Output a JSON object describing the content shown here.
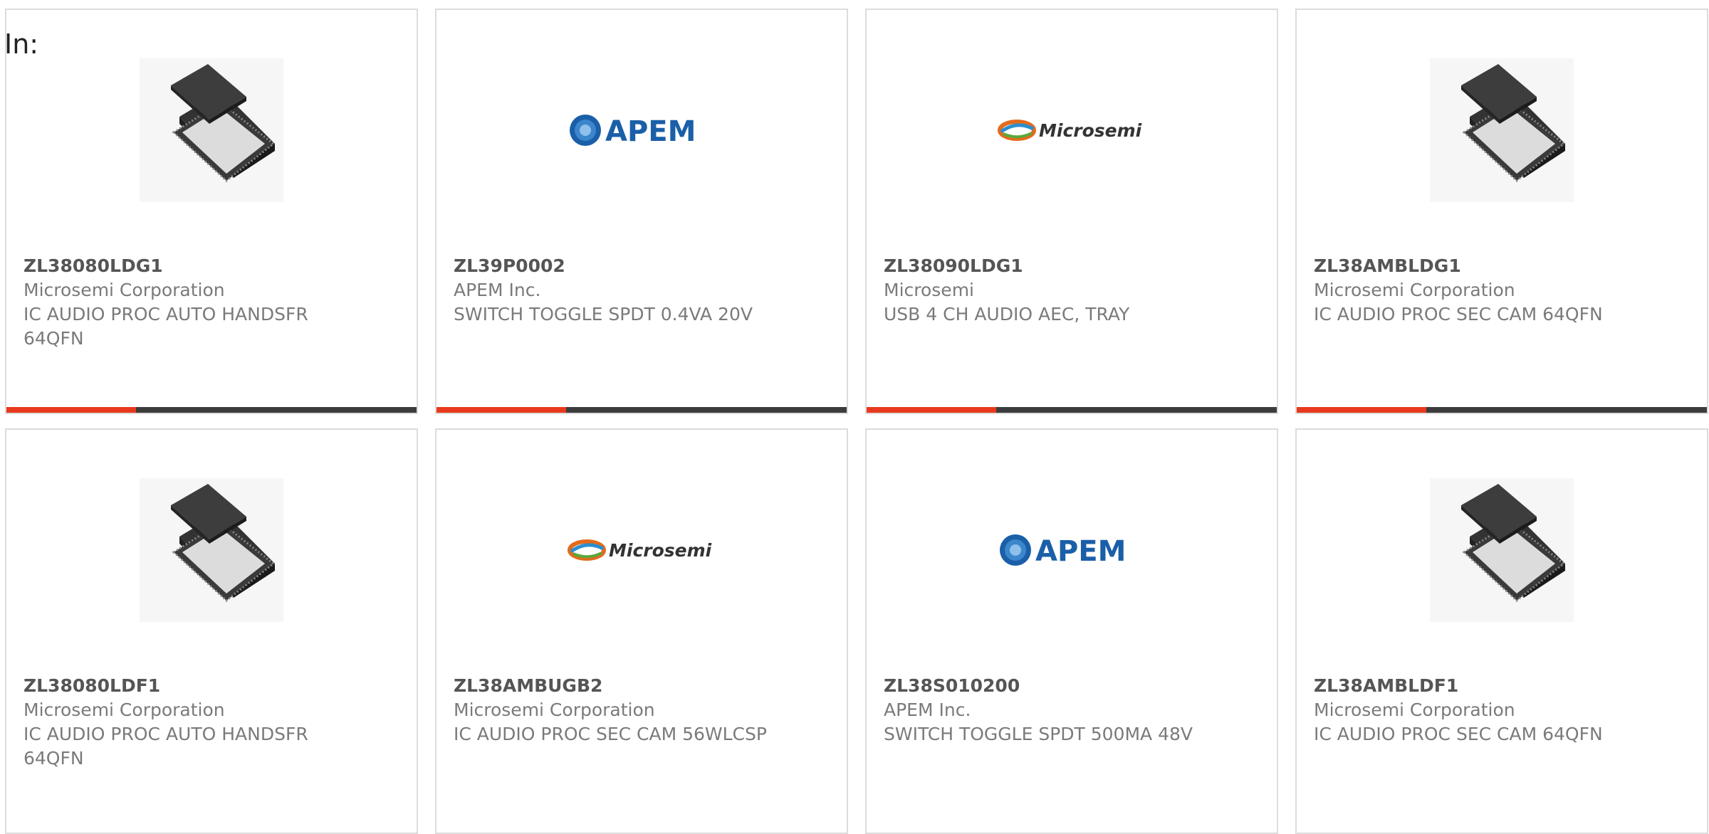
{
  "filter": {
    "prefix_label": "In:"
  },
  "colors": {
    "card_border": "#dcdcdc",
    "text_primary": "#555555",
    "text_secondary": "#7a7a7a",
    "accent_orange": "#e8391d",
    "bar_dark": "#3c3c3c",
    "apem_blue": "#1a5fa8"
  },
  "products": [
    {
      "part_number": "ZL38080LDG1",
      "manufacturer": "Microsemi Corporation",
      "description": "IC AUDIO PROC AUTO HANDSFR 64QFN",
      "image": "qfn-chip-icon"
    },
    {
      "part_number": "ZL39P0002",
      "manufacturer": "APEM Inc.",
      "description": "SWITCH TOGGLE SPDT 0.4VA 20V",
      "image": "apem-logo",
      "logo_text": "APEM"
    },
    {
      "part_number": "ZL38090LDG1",
      "manufacturer": "Microsemi",
      "description": "USB 4 CH AUDIO AEC, TRAY",
      "image": "microsemi-logo",
      "logo_text": "Microsemi"
    },
    {
      "part_number": "ZL38AMBLDG1",
      "manufacturer": "Microsemi Corporation",
      "description": "IC AUDIO PROC SEC CAM 64QFN",
      "image": "qfn-chip-icon"
    },
    {
      "part_number": "ZL38080LDF1",
      "manufacturer": "Microsemi Corporation",
      "description": "IC AUDIO PROC AUTO HANDSFR 64QFN",
      "image": "qfn-chip-icon"
    },
    {
      "part_number": "ZL38AMBUGB2",
      "manufacturer": "Microsemi Corporation",
      "description": "IC AUDIO PROC SEC CAM 56WLCSP",
      "image": "microsemi-logo",
      "logo_text": "Microsemi"
    },
    {
      "part_number": "ZL38S010200",
      "manufacturer": "APEM Inc.",
      "description": "SWITCH TOGGLE SPDT 500MA 48V",
      "image": "apem-logo",
      "logo_text": "APEM"
    },
    {
      "part_number": "ZL38AMBLDF1",
      "manufacturer": "Microsemi Corporation",
      "description": "IC AUDIO PROC SEC CAM 64QFN",
      "image": "qfn-chip-icon"
    }
  ]
}
